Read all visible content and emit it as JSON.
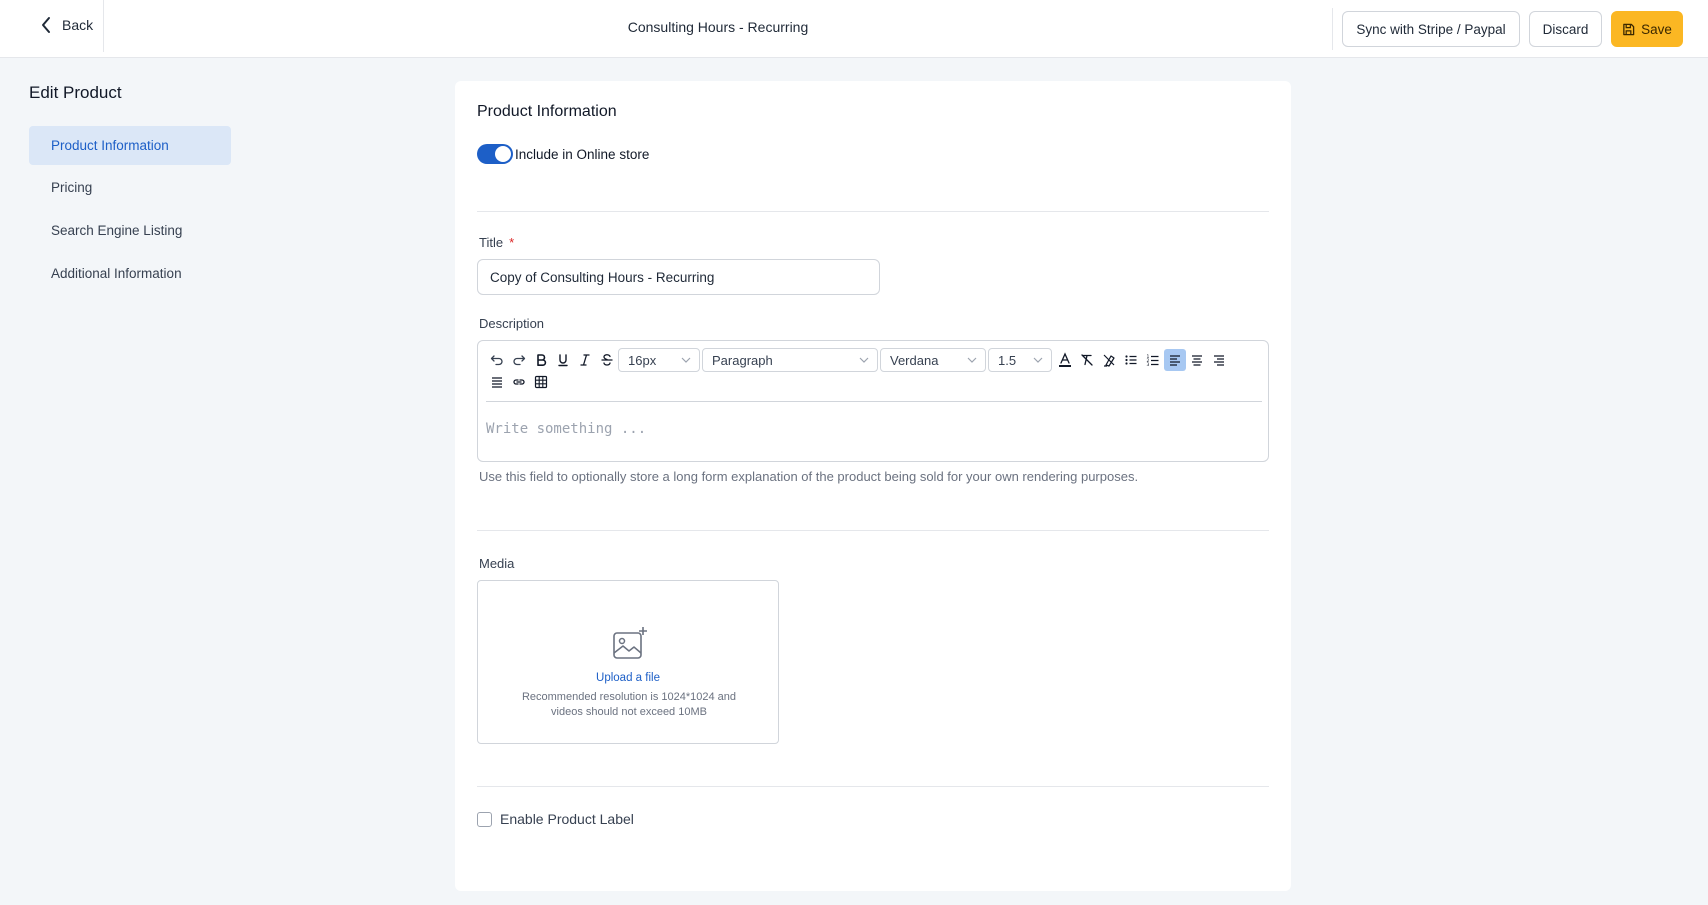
{
  "header": {
    "back_label": "Back",
    "page_title": "Consulting Hours - Recurring",
    "sync_label": "Sync with Stripe / Paypal",
    "discard_label": "Discard",
    "save_label": "Save"
  },
  "sidebar": {
    "title": "Edit Product",
    "items": [
      {
        "label": "Product Information",
        "active": true
      },
      {
        "label": "Pricing",
        "active": false
      },
      {
        "label": "Search Engine Listing",
        "active": false
      },
      {
        "label": "Additional Information",
        "active": false
      }
    ]
  },
  "main": {
    "section_title": "Product Information",
    "online_store_toggle": {
      "label": "Include in Online store",
      "on": true
    },
    "title_field": {
      "label": "Title",
      "required_mark": "*",
      "value": "Copy of Consulting Hours - Recurring"
    },
    "description": {
      "label": "Description",
      "font_size": "16px",
      "block_format": "Paragraph",
      "font_family": "Verdana",
      "line_height": "1.5",
      "placeholder": "Write something ...",
      "help_text": "Use this field to optionally store a long form explanation of the product being sold for your own rendering purposes."
    },
    "media": {
      "label": "Media",
      "upload_link": "Upload a file",
      "hint_line1": "Recommended resolution is 1024*1024 and",
      "hint_line2": "videos should not exceed 10MB"
    },
    "product_label_checkbox": {
      "label": "Enable Product Label",
      "checked": false
    }
  },
  "colors": {
    "accent_blue": "#1d5fc7",
    "save_yellow": "#fbb723",
    "page_bg": "#f3f6f9",
    "active_nav_bg": "#dbe7f7"
  }
}
